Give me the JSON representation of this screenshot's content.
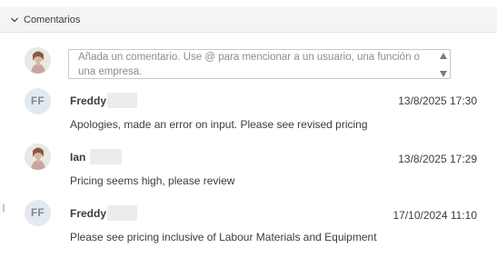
{
  "section": {
    "title": "Comentarios",
    "chevron_icon": "chevron-down-icon"
  },
  "new_comment": {
    "placeholder": "Añada un comentario. Use @ para mencionar a un usuario, una función o una empresa."
  },
  "comments": [
    {
      "initials": "FF",
      "avatar_type": "initials",
      "author": "Freddy",
      "timestamp": "13/8/2025 17:30",
      "text": "Apologies, made an error on input. Please see revised pricing"
    },
    {
      "avatar_type": "photo",
      "author": "Ian",
      "timestamp": "13/8/2025 17:29",
      "text": "Pricing seems high, please review"
    },
    {
      "initials": "FF",
      "avatar_type": "initials",
      "author": "Freddy",
      "timestamp": "17/10/2024 11:10",
      "text": "Please see pricing inclusive of Labour Materials and Equipment"
    }
  ],
  "colors": {
    "header_bg": "#f4f4f4",
    "avatar_initials_bg": "#e4e9ef",
    "avatar_initials_fg": "#7b8796",
    "text": "#3c3c3c",
    "placeholder": "#8c8c8c"
  }
}
